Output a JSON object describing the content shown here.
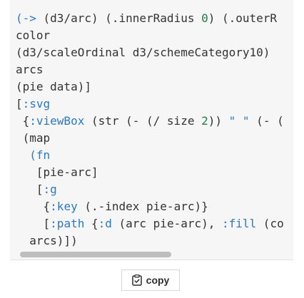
{
  "code": {
    "lines": [
      "(-> (d3/arc) (.innerRadius 0) (.outerR",
      "color",
      "(d3/scaleOrdinal d3/schemeCategory10)",
      "arcs",
      "(pie data)]",
      "[:svg",
      " {:viewBox (str (- (/ size 2)) \" \" (- (",
      " (map",
      "  (fn",
      "   [pie-arc]",
      "   [:g",
      "    {:key (.-index pie-arc)}",
      "    [:path {:d (arc pie-arc), :fill (co",
      "  arcs)])"
    ]
  },
  "copy_button": {
    "label": "copy",
    "icon": "clipboard-check-icon"
  },
  "colors": {
    "keyword": "#2b78c5",
    "number": "#1a7f4b",
    "text": "#333333",
    "panel_bg": "#f6f6f6"
  }
}
